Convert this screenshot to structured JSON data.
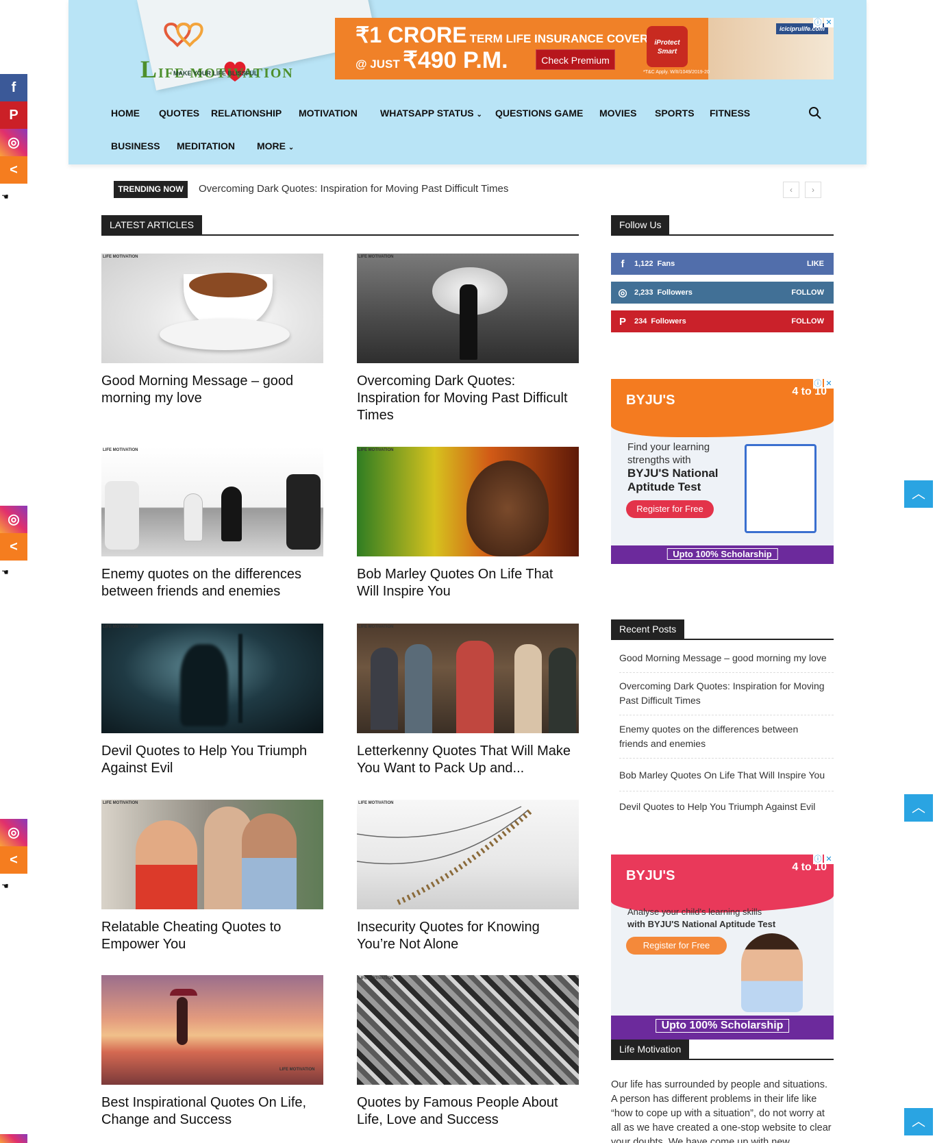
{
  "logo": {
    "text_first": "L",
    "text_rest": "IFE MOTIVATION",
    "tagline": "MAKE YOUR LIFE BLISSFUL"
  },
  "top_ad": {
    "line1_big": "₹1 CRORE",
    "line1_small": "TERM LIFE INSURANCE COVER",
    "line2_small": "@ JUST",
    "line2_big": "₹490 P.M.",
    "cta": "Check Premium",
    "badge": "iProtect Smart",
    "brand": "iciciprulife.com",
    "disclaimer": "*T&C Apply. W/II/1049/2019-20"
  },
  "nav": {
    "row1": [
      "HOME",
      "QUOTES",
      "RELATIONSHIP",
      "MOTIVATION",
      "WHATSAPP STATUS",
      "QUESTIONS GAME",
      "MOVIES",
      "SPORTS",
      "FITNESS"
    ],
    "row2": [
      "BUSINESS",
      "MEDITATION",
      "MORE"
    ]
  },
  "trending": {
    "label": "TRENDING NOW",
    "text": "Overcoming Dark Quotes: Inspiration for Moving Past Difficult Times"
  },
  "latest": {
    "heading": "LATEST ARTICLES",
    "articles": [
      {
        "title": "Good Morning Message – good morning my love"
      },
      {
        "title": "Overcoming Dark Quotes: Inspiration for Moving Past Difficult Times"
      },
      {
        "title": "Enemy quotes on the differences between friends and enemies"
      },
      {
        "title": "Bob Marley Quotes On Life That Will Inspire You"
      },
      {
        "title": "Devil Quotes to Help You Triumph Against Evil"
      },
      {
        "title": "Letterkenny Quotes That Will Make You Want to Pack Up and..."
      },
      {
        "title": "Relatable Cheating Quotes to Empower You"
      },
      {
        "title": "Insecurity Quotes for Knowing You’re Not Alone"
      },
      {
        "title": "Best Inspirational Quotes On Life, Change and Success"
      },
      {
        "title": "Quotes by Famous People About Life, Love and Success"
      }
    ],
    "watermark": "LIFE MOTIVATION"
  },
  "follow": {
    "heading": "Follow Us",
    "items": [
      {
        "icon": "facebook-icon",
        "count": "1,122",
        "unit": "Fans",
        "action": "LIKE",
        "color": "#516eab"
      },
      {
        "icon": "instagram-icon",
        "count": "2,233",
        "unit": "Followers",
        "action": "FOLLOW",
        "color": "#417096"
      },
      {
        "icon": "pinterest-icon",
        "count": "234",
        "unit": "Followers",
        "action": "FOLLOW",
        "color": "#ca212a"
      }
    ]
  },
  "byju_ad1": {
    "logo": "BYJU'S",
    "grade": "4 to 10",
    "line1": "Find your learning",
    "line2": "strengths with",
    "bold1": "BYJU'S National",
    "bold2": "Aptitude Test",
    "cta": "Register for Free",
    "bar": "Upto 100% Scholarship"
  },
  "recent": {
    "heading": "Recent Posts",
    "items": [
      "Good Morning Message – good morning my love",
      "Overcoming Dark Quotes: Inspiration for Moving Past Difficult Times",
      "Enemy quotes on the differences between friends and enemies",
      "Bob Marley Quotes On Life That Will Inspire You",
      "Devil Quotes to Help You Triumph Against Evil"
    ]
  },
  "byju_ad2": {
    "logo": "BYJU'S",
    "grade": "4 to 10",
    "line1": "Analyse your child's learning skills",
    "line2": "with BYJU'S National Aptitude Test",
    "cta": "Register for Free",
    "bar": "Upto 100% Scholarship"
  },
  "about": {
    "heading": "Life Motivation",
    "text": "Our life has surrounded by people and situations. A person has different problems in their life like “how to cope up with a situation”, do not worry at all as we have created a one-stop website to clear your doubts. We have come up with new"
  },
  "colors": {
    "facebook": "#3b5998",
    "pinterest": "#cb2027",
    "share": "#f57d1f",
    "totop": "#2aa4e2",
    "header_bg": "#b9e4f6"
  }
}
